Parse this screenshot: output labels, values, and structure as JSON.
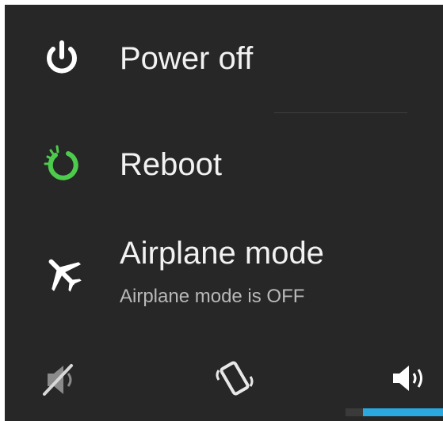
{
  "power_menu": {
    "items": [
      {
        "label": "Power off",
        "icon": "power-icon"
      },
      {
        "label": "Reboot",
        "icon": "reboot-icon"
      },
      {
        "label": "Airplane mode",
        "sublabel": "Airplane mode is OFF",
        "icon": "airplane-icon"
      }
    ],
    "sound_modes": [
      {
        "icon": "silent-icon",
        "selected": false
      },
      {
        "icon": "vibrate-icon",
        "selected": false
      },
      {
        "icon": "sound-on-icon",
        "selected": true
      }
    ]
  },
  "colors": {
    "background": "#272727",
    "text": "#f2f2f2",
    "subtext": "#b9b9b9",
    "reboot_accent": "#4ccb4c",
    "selected_indicator": "#2aa8e0"
  }
}
